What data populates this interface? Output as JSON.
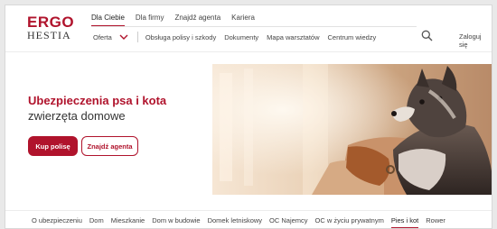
{
  "logo": {
    "line1": "ERGO",
    "line2": "HESTIA"
  },
  "topnav": [
    "Dla Ciebie",
    "Dla firmy",
    "Znajdź agenta",
    "Kariera"
  ],
  "subnav": {
    "oferta": "Oferta",
    "items": [
      "Obsługa polisy i szkody",
      "Dokumenty",
      "Mapa warsztatów",
      "Centrum wiedzy"
    ]
  },
  "header": {
    "login": "Zaloguj się"
  },
  "hero": {
    "title": "Ubezpieczenia psa i kota",
    "subtitle": "zwierzęta domowe",
    "primary_button": "Kup polisę",
    "secondary_button": "Znajdź agenta"
  },
  "tabs": [
    "O ubezpieczeniu",
    "Dom",
    "Mieszkanie",
    "Dom w budowie",
    "Domek letniskowy",
    "OC Najemcy",
    "OC w życiu prywatnym",
    "Pies i kot",
    "Rower"
  ],
  "active": {
    "topnav": "Dla Ciebie",
    "tab": "Pies i kot"
  },
  "colors": {
    "brand": "#b0132c"
  },
  "icons": {
    "search": "search-icon",
    "chevron": "chevron-down-icon"
  }
}
